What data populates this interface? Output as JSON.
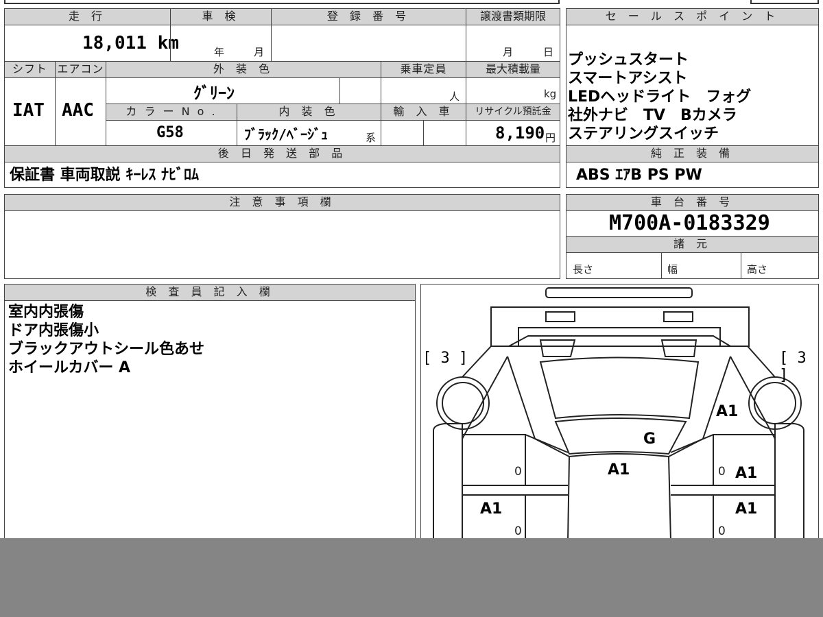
{
  "top": {
    "mileage_header": "走 行",
    "mileage": "18,011 km",
    "inspection_header": "車 検",
    "inspection_year": "年",
    "inspection_month": "月",
    "registration_header": "登 録 番 号",
    "transfer_deadline_header": "譲渡書類期限",
    "transfer_month": "月",
    "transfer_day": "日"
  },
  "specs": {
    "shift_header": "シフト",
    "shift": "IAT",
    "ac_header": "エアコン",
    "ac": "AAC",
    "ext_color_header": "外 装 色",
    "ext_color": "ｸﾞﾘｰﾝ",
    "capacity_header": "乗車定員",
    "capacity_unit": "人",
    "max_load_header": "最大積載量",
    "max_load_unit": "kg",
    "color_no_header": "カ ラ ー N o .",
    "color_no": "G58",
    "int_color_header": "内 装 色",
    "int_color": "ﾌﾞﾗｯｸ/ﾍﾞｰｼﾞｭ",
    "int_color_suffix": "系",
    "import_header": "輸 入 車",
    "recycle_header": "リサイクル預託金",
    "recycle_value": "8,190",
    "recycle_unit": "円"
  },
  "later_parts": {
    "header": "後 日 発 送 部 品",
    "value": "保証書 車両取説 ｷｰﾚｽ ﾅﾋﾞﾛﾑ"
  },
  "sales_points": {
    "header": "セ ー ル ス ポ イ ン ト",
    "lines": [
      "プッシュスタート",
      "スマートアシスト",
      "LEDヘッドライト　フォグ",
      "社外ナビ　TV　Bカメラ",
      "ステアリングスイッチ"
    ]
  },
  "factory_equipment": {
    "header": "純 正 装 備",
    "value": "ABS ｴｱB PS PW"
  },
  "notes": {
    "header": "注 意 事 項 欄"
  },
  "chassis": {
    "header": "車 台 番 号",
    "value": "M700A-0183329",
    "spec_header": "諸 元",
    "length_label": "長さ",
    "width_label": "幅",
    "height_label": "高さ"
  },
  "inspector": {
    "header": "検 査 員 記 入 欄",
    "lines": [
      "室内内張傷",
      "ドア内張傷小",
      "ブラックアウトシール色あせ",
      "ホイールカバー A"
    ]
  },
  "diagram": {
    "tire_left": "[ 3 ]",
    "tire_right": "[ 3 ]",
    "marks": {
      "right_front_fender": "A1",
      "windshield": "G",
      "hood": "A1",
      "right_front_door": "A1",
      "left_rear_door": "A1",
      "right_rear_door": "A1",
      "zero_a": "0",
      "zero_b": "0",
      "zero_c": "0",
      "zero_d": "0"
    }
  }
}
